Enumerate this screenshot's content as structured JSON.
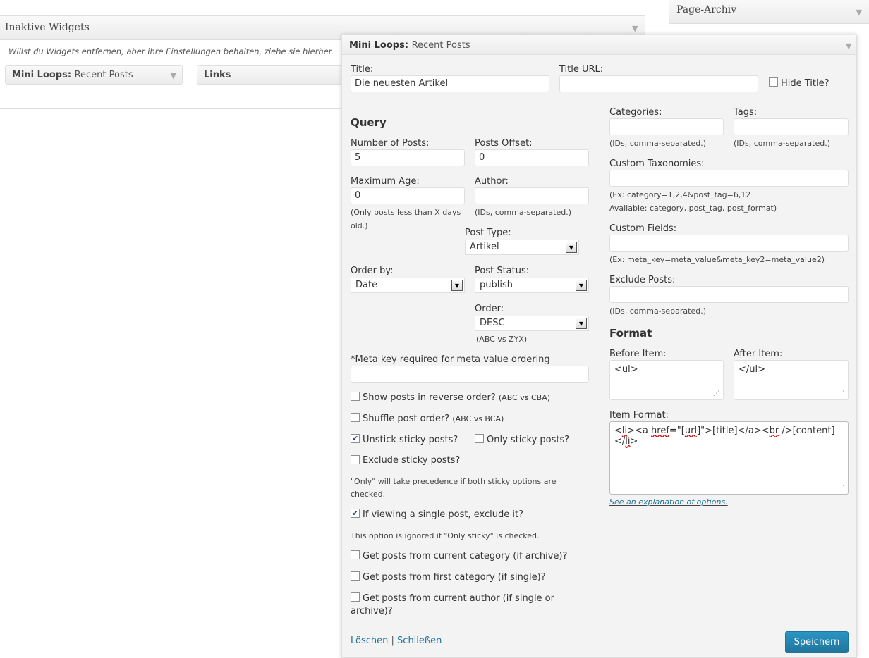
{
  "inactive": {
    "title": "Inaktive Widgets",
    "description": "Willst du Widgets entfernen, aber ihre Einstellungen behalten, ziehe sie hierher.",
    "widgets": [
      {
        "name": "Mini Loops:",
        "sub": "Recent Posts"
      },
      {
        "name": "Links"
      }
    ]
  },
  "archive": {
    "title": "Page-Archiv"
  },
  "widget": {
    "title": "Mini Loops:",
    "subtitle": "Recent Posts",
    "title_label": "Title:",
    "title_value": "Die neuesten Artikel",
    "title_url_label": "Title URL:",
    "title_url_value": "",
    "hide_title_label": "Hide Title?",
    "query_heading": "Query",
    "num_posts_label": "Number of Posts:",
    "num_posts_value": "5",
    "offset_label": "Posts Offset:",
    "offset_value": "0",
    "max_age_label": "Maximum Age:",
    "max_age_value": "0",
    "max_age_hint_1": "(Only posts less than X days",
    "max_age_hint_2": "old.)",
    "author_label": "Author:",
    "author_value": "",
    "author_hint": "(IDs, comma-separated.)",
    "post_type_label": "Post Type:",
    "post_type_value": "Artikel",
    "order_by_label": "Order by:",
    "order_by_value": "Date",
    "post_status_label": "Post Status:",
    "post_status_value": "publish",
    "order_label": "Order:",
    "order_value": "DESC",
    "order_hint": "(ABC vs ZYX)",
    "meta_key_label": "*Meta key required for meta value ordering",
    "meta_key_value": "",
    "reverse_label": "Show posts in reverse order?",
    "reverse_hint": "(ABC vs CBA)",
    "shuffle_label": "Shuffle post order?",
    "shuffle_hint": "(ABC vs BCA)",
    "unstick_label": "Unstick sticky posts?",
    "only_sticky_label": "Only sticky posts?",
    "exclude_sticky_label": "Exclude sticky posts?",
    "sticky_note_1": "\"Only\" will take precedence if both sticky options are",
    "sticky_note_2": "checked.",
    "exclude_single_label": "If viewing a single post, exclude it?",
    "exclude_single_note": "This option is ignored if \"Only sticky\" is checked.",
    "current_cat_label": "Get posts from current category (if archive)?",
    "first_cat_label": "Get posts from first category (if single)?",
    "current_author_label_1": "Get posts from current author (if single or",
    "current_author_label_2": "archive)?",
    "delete_link": "Löschen",
    "separator": "|",
    "close_link": "Schließen",
    "categories_label": "Categories:",
    "categories_hint": "(IDs, comma-separated.)",
    "tags_label": "Tags:",
    "tags_hint": "(IDs, comma-separated.)",
    "custom_tax_label": "Custom Taxonomies:",
    "custom_tax_hint_1": "(Ex: category=1,2,4&post_tag=6,12",
    "custom_tax_hint_2": "Available: category, post_tag, post_format)",
    "custom_fields_label": "Custom Fields:",
    "custom_fields_hint": "(Ex: meta_key=meta_value&meta_key2=meta_value2)",
    "exclude_posts_label": "Exclude Posts:",
    "exclude_posts_hint": "(IDs, comma-separated.)",
    "format_heading": "Format",
    "before_item_label": "Before Item:",
    "before_item_value": "<ul>",
    "after_item_label": "After Item:",
    "after_item_value": "</ul>",
    "item_format_label": "Item Format:",
    "item_format_parts": [
      "<",
      "li",
      "><a ",
      "href",
      "=\"[",
      "url",
      "]\">[title]</a><",
      "br",
      " />[content]</",
      "li",
      ">"
    ],
    "explanation_link": "See an explanation of options.",
    "save_button": "Speichern"
  },
  "checked": {
    "hide_title": false,
    "reverse": false,
    "shuffle": false,
    "unstick": true,
    "only_sticky": false,
    "exclude_sticky": false,
    "exclude_single": true,
    "current_cat": false,
    "first_cat": false,
    "current_author": false
  },
  "icons": {
    "arrow": "▼",
    "check": "✔",
    "grip": "⋰"
  }
}
